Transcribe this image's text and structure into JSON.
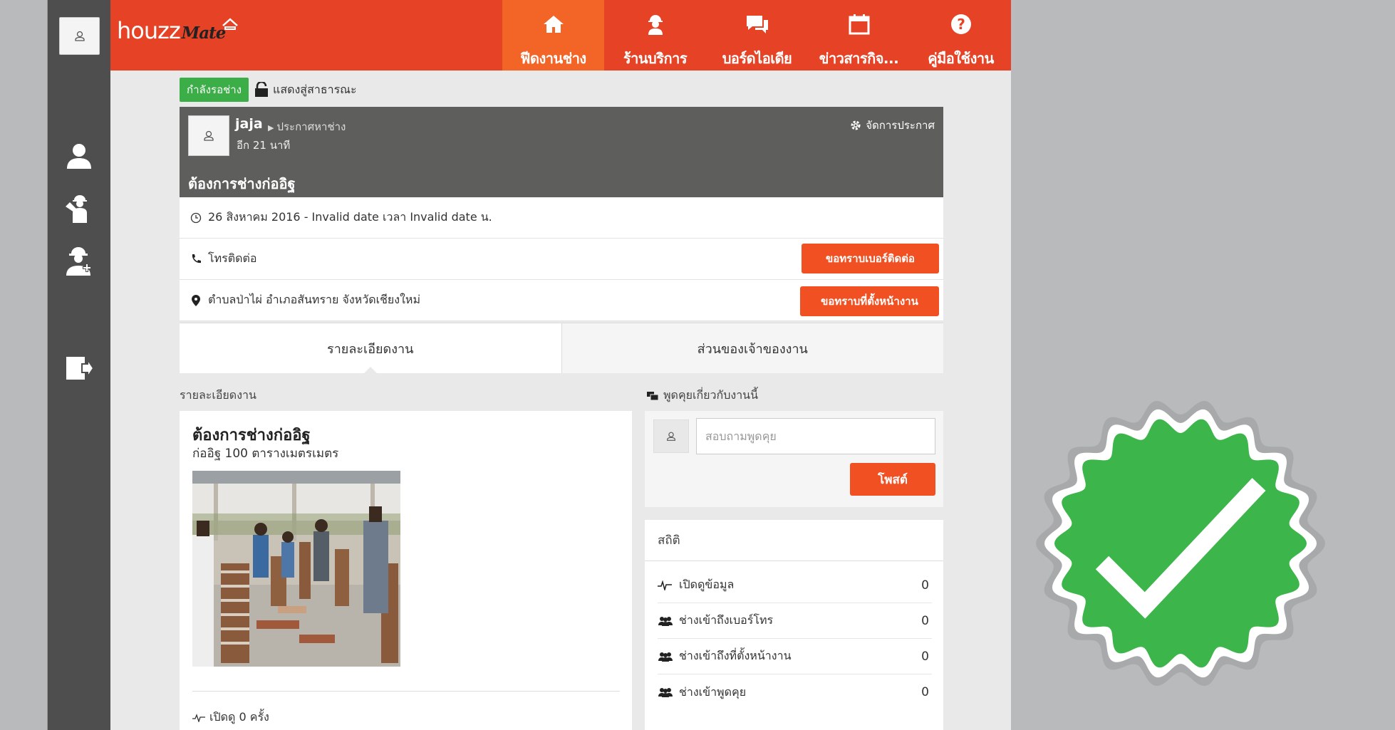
{
  "brand": {
    "name": "houzz",
    "suffix": "Mate"
  },
  "nav": [
    {
      "label": "ฟีดงานช่าง",
      "icon": "home-icon",
      "active": true
    },
    {
      "label": "ร้านบริการ",
      "icon": "worker-icon",
      "active": false
    },
    {
      "label": "บอร์ดไอเดีย",
      "icon": "chat-icon",
      "active": false
    },
    {
      "label": "ข่าวสารกิจ...",
      "icon": "calendar-icon",
      "active": false
    },
    {
      "label": "คู่มือใช้งาน",
      "icon": "help-icon",
      "active": false
    }
  ],
  "sidebar": [
    "profile-icon",
    "worker-icon",
    "builder-icon",
    "logout-icon"
  ],
  "job": {
    "status": "กำลังรอช่าง",
    "visibility": "แสดงสู่สาธารณะ",
    "poster": "jaja",
    "poster_role": "ประกาศหาช่าง",
    "time_left": "อีก 21 นาที",
    "manage_label": "จัดการประกาศ",
    "title": "ต้องการช่างก่ออิฐ",
    "date": "26 สิงหาคม 2016 - Invalid date เวลา Invalid date น.",
    "phone_label": "โทรติดต่อ",
    "phone_button": "ขอทราบเบอร์ติดต่อ",
    "location": "ตำบลป่าไผ่ อำเภอสันทราย จังหวัดเชียงใหม่",
    "location_button": "ขอทราบที่ตั้งหน้างาน"
  },
  "tabs": [
    "รายละเอียดงาน",
    "ส่วนของเจ้าของงาน"
  ],
  "detail": {
    "section_label": "รายละเอียดงาน",
    "title": "ต้องการช่างก่ออิฐ",
    "subtitle": "ก่ออิฐ 100 ตารางเมตรเมตร",
    "views": "เปิดดู 0 ครั้ง"
  },
  "chat": {
    "section_label": "พูดคุยเกี่ยวกับงานนี้",
    "placeholder": "สอบถามพูดคุย",
    "post_button": "โพสต์"
  },
  "stats": {
    "title": "สถิติ",
    "rows": [
      {
        "label": "เปิดดูข้อมูล",
        "value": "0",
        "icon": "pulse-icon"
      },
      {
        "label": "ช่างเข้าถึงเบอร์โทร",
        "value": "0",
        "icon": "users-icon"
      },
      {
        "label": "ช่างเข้าถึงที่ตั้งหน้างาน",
        "value": "0",
        "icon": "users-icon"
      },
      {
        "label": "ช่างเข้าพูดคุย",
        "value": "0",
        "icon": "users-icon"
      }
    ]
  },
  "colors": {
    "brand": "#e64326",
    "active_nav": "#f26527",
    "sidebar": "#4e4e4e",
    "status": "#3cae48",
    "button": "#f05022",
    "badge": "#3cb54a"
  }
}
